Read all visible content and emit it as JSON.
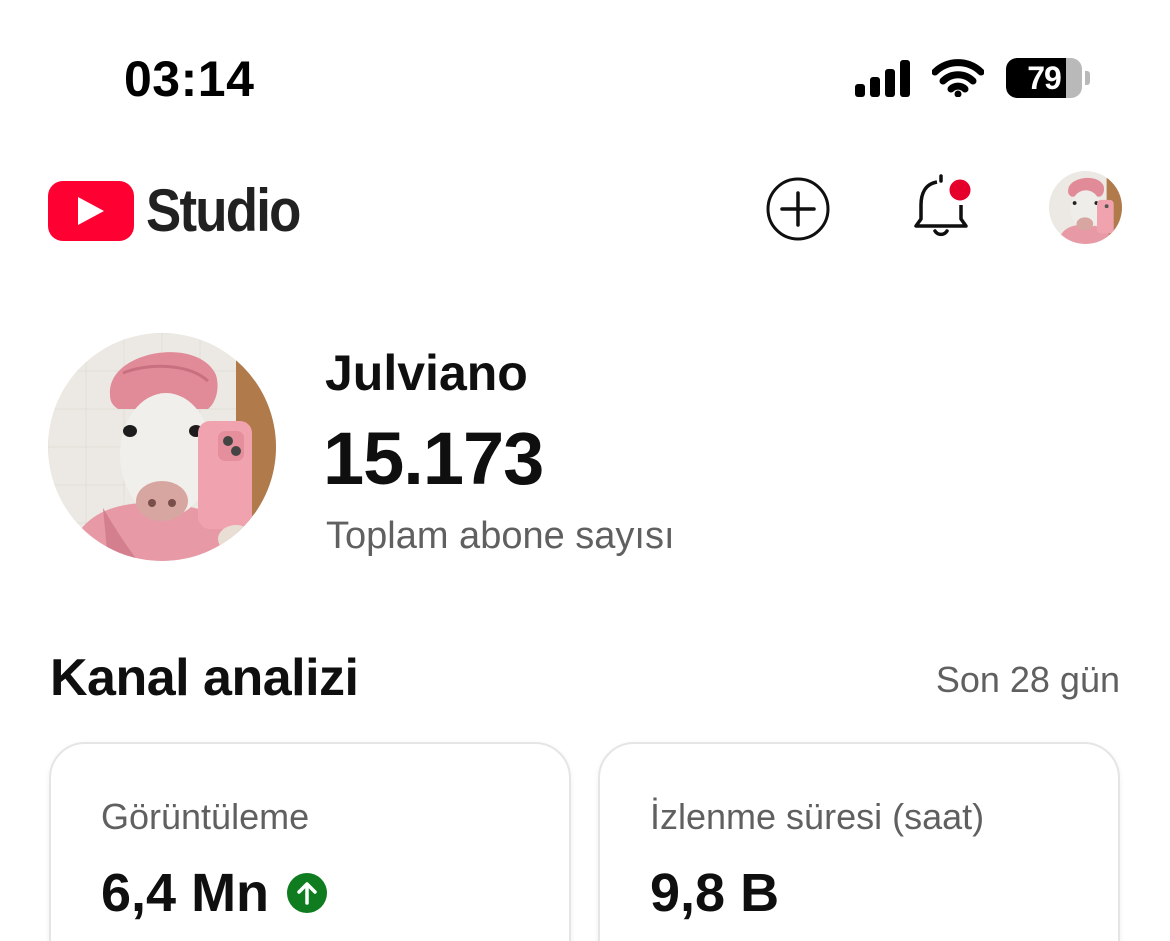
{
  "status_bar": {
    "time": "03:14",
    "battery_level": "79",
    "battery_percent": 79,
    "icons": [
      "cellular-signal-icon",
      "wifi-icon",
      "battery-icon"
    ]
  },
  "header": {
    "app_name": "Studio",
    "logo_icon": "youtube-play-icon",
    "brand_color": "#ff0033",
    "actions": [
      "create-plus-icon",
      "notifications-bell-icon",
      "account-avatar"
    ],
    "notification_dot_color": "#e5002b"
  },
  "channel": {
    "name": "Julviano",
    "subscriber_count": "15.173",
    "subscriber_label": "Toplam abone sayısı"
  },
  "analytics": {
    "title": "Kanal analizi",
    "period": "Son 28 gün",
    "cards": [
      {
        "label": "Görüntüleme",
        "value": "6,4 Mn",
        "trend": "up",
        "trend_color": "#0f7c1f"
      },
      {
        "label": "İzlenme süresi (saat)",
        "value": "9,8 B"
      }
    ]
  }
}
